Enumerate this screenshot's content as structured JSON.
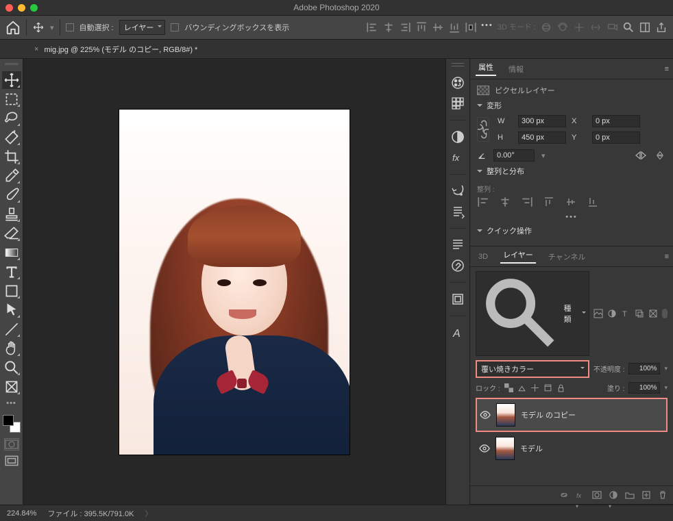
{
  "app": {
    "title": "Adobe Photoshop 2020"
  },
  "doctab": {
    "label": "mig.jpg @ 225% (モデル のコピー, RGB/8#) *"
  },
  "options": {
    "auto_select": "自動選択 :",
    "layer_target": "レイヤー",
    "show_bbox": "バウンディングボックスを表示",
    "mode3d": "3D モード :"
  },
  "panels": {
    "properties": {
      "tab1": "属性",
      "tab2": "情報",
      "pixel_layer": "ピクセルレイヤー"
    },
    "transform": {
      "header": "変形",
      "W": "W",
      "Wv": "300 px",
      "X": "X",
      "Xv": "0 px",
      "H": "H",
      "Hv": "450 px",
      "Y": "Y",
      "Yv": "0 px",
      "angle": "0.00°"
    },
    "align": {
      "header": "整列と分布",
      "label": "整列 :"
    },
    "quick": {
      "header": "クイック操作"
    },
    "layers": {
      "tab3d": "3D",
      "tabLayers": "レイヤー",
      "tabChannels": "チャンネル",
      "kind": "種類",
      "blend": "覆い焼きカラー",
      "opacity_label": "不透明度 :",
      "opacity_val": "100%",
      "lock_label": "ロック :",
      "fill_label": "塗り :",
      "fill_val": "100%",
      "layer1": "モデル のコピー",
      "layer2": "モデル"
    }
  },
  "status": {
    "zoom": "224.84%",
    "file_label": "ファイル :",
    "file_val": "395.5K/791.0K"
  }
}
